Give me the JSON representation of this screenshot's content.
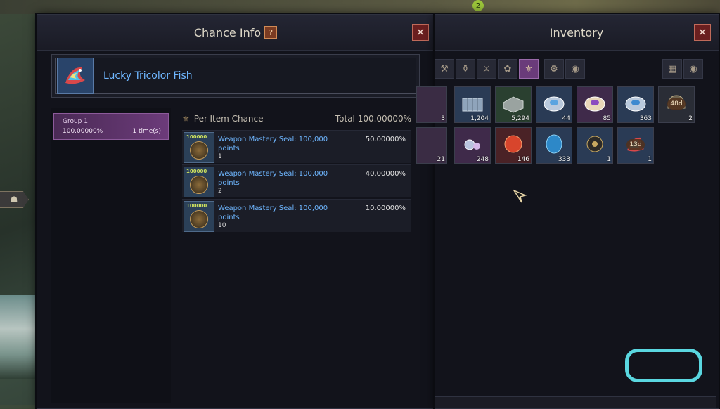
{
  "chance_info": {
    "title": "Chance Info",
    "help_label": "?",
    "close_label": "✕",
    "item_name": "Lucky Tricolor Fish",
    "group": {
      "title": "Group 1",
      "percent": "100.00000%",
      "times": "1 time(s)"
    },
    "per_item_label": "Per-Item Chance",
    "total_label": "Total 100.00000%",
    "rows": [
      {
        "name": "Weapon Mastery Seal: 100,000 points",
        "qty": "1",
        "percent": "50.00000%",
        "icon_num": "100000"
      },
      {
        "name": "Weapon Mastery Seal: 100,000 points",
        "qty": "2",
        "percent": "40.00000%",
        "icon_num": "100000"
      },
      {
        "name": "Weapon Mastery Seal: 100,000 points",
        "qty": "10",
        "percent": "10.00000%",
        "icon_num": "100000"
      }
    ]
  },
  "inventory": {
    "title": "Inventory",
    "close_label": "✕",
    "tabs": [
      {
        "icon": "hammer-icon",
        "glyph": "⚒"
      },
      {
        "icon": "pouch-icon",
        "glyph": "⚱"
      },
      {
        "icon": "anvil-icon",
        "glyph": "⚔"
      },
      {
        "icon": "herb-icon",
        "glyph": "✿"
      },
      {
        "icon": "bag-icon",
        "glyph": "⚜",
        "active": true
      },
      {
        "icon": "gear-icon",
        "glyph": "⚙"
      },
      {
        "icon": "coins-icon",
        "glyph": "◉"
      }
    ],
    "grid_toggle": "▦",
    "view_toggle": "◉",
    "slots_row1": [
      {
        "name": "partial-item-slot",
        "count": "3",
        "color": "#3a2c44"
      },
      {
        "name": "iron-crate-slot",
        "count": "1,204",
        "color": "#2a3b55"
      },
      {
        "name": "stone-block-slot",
        "count": "5,294",
        "color": "#2a4030"
      },
      {
        "name": "crystal-chest-slot",
        "count": "44",
        "color": "#2a3b55"
      },
      {
        "name": "purple-chest-slot",
        "count": "85",
        "color": "#3f2a4a"
      },
      {
        "name": "blue-chest-slot",
        "count": "363",
        "color": "#2a3b55"
      },
      {
        "name": "helmet-slot",
        "count": "2",
        "badge": "48d",
        "color": "#2a2d36"
      }
    ],
    "slots_row2": [
      {
        "name": "partial-gem-slot",
        "count": "21",
        "color": "#3a2c44"
      },
      {
        "name": "jewel-slot",
        "count": "248",
        "color": "#3f2a4a"
      },
      {
        "name": "red-orb-slot",
        "count": "146",
        "color": "#4a2226"
      },
      {
        "name": "blue-orb-slot",
        "count": "333",
        "color": "#2a3b55"
      },
      {
        "name": "dark-orb-slot",
        "count": "1",
        "color": "#2a3b55"
      },
      {
        "name": "tricolor-fish-slot",
        "count": "1",
        "badge": "13d",
        "color": "#2a3b55"
      }
    ]
  },
  "hud": {
    "badge_num": "2"
  }
}
